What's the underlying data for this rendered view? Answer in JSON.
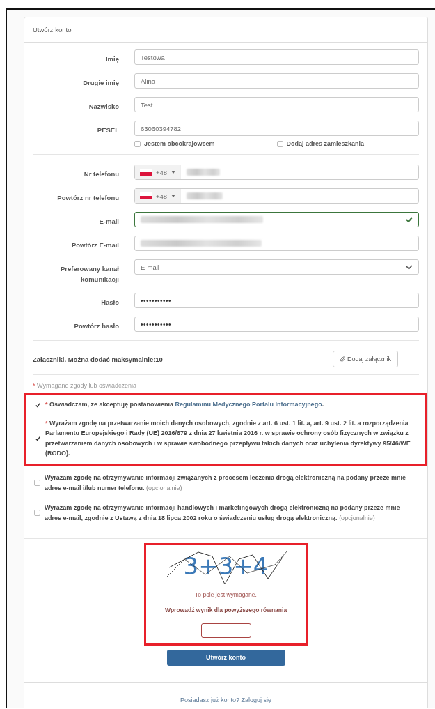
{
  "card_title": "Utwórz konto",
  "personal_fields": [
    {
      "label": "Imię",
      "value": "Testowa"
    },
    {
      "label": "Drugie imię",
      "value": "Alina"
    },
    {
      "label": "Nazwisko",
      "value": "Test"
    },
    {
      "label": "PESEL",
      "value": "63060394782"
    }
  ],
  "pesel_options": [
    {
      "label": "Jestem obcokrajowcem",
      "checked": false
    },
    {
      "label": "Dodaj adres zamieszkania",
      "checked": false
    }
  ],
  "contact_fields": [
    {
      "kind": "phone",
      "label": "Nr telefonu",
      "code": "+48"
    },
    {
      "kind": "phone",
      "label": "Powtórz nr telefonu",
      "code": "+48"
    },
    {
      "kind": "email",
      "label": "E-mail",
      "valid": true
    },
    {
      "kind": "email",
      "label": "Powtórz E-mail",
      "valid": false
    },
    {
      "kind": "select",
      "label": "Preferowany kanał komunikacji",
      "value": "E-mail"
    },
    {
      "kind": "password",
      "label": "Hasło",
      "value": "•••••••••••"
    },
    {
      "kind": "password",
      "label": "Powtórz hasło",
      "value": "•••••••••••"
    }
  ],
  "attachments": {
    "text": "Załączniki. Można dodać maksymalnie:10",
    "button": "Dodaj załącznik"
  },
  "consents_heading": {
    "mark": "*",
    "text": "Wymagane zgody lub oświadczenia"
  },
  "required_consents": {
    "highlighted": true,
    "items": [
      {
        "checked": true,
        "mark": "*",
        "text": "Oświadczam, że akceptuję postanowienia ",
        "link": "Regulaminu Medycznego Portalu Informacyjnego",
        "text_after": "."
      },
      {
        "checked": true,
        "mark": "*",
        "text": "Wyrażam zgodę na przetwarzanie moich danych osobowych, zgodnie z art. 6 ust. 1 lit. a, art. 9 ust. 2 lit. a rozporządzenia Parlamentu Europejskiego i Rady (UE) 2016/679 z dnia 27 kwietnia 2016 r. w sprawie ochrony osób fizycznych w związku z przetwarzaniem danych osobowych i w sprawie swobodnego przepływu takich danych oraz uchylenia dyrektywy 95/46/WE (RODO)."
      }
    ]
  },
  "optional_consents": [
    {
      "checked": false,
      "text": "Wyrażam zgodę na otrzymywanie informacji związanych z procesem leczenia drogą elektroniczną na podany przeze mnie adres e-mail i/lub numer telefonu. ",
      "note": "(opcjonalnie)"
    },
    {
      "checked": false,
      "text": "Wyrażam zgodę na otrzymywanie informacji handlowych i marketingowych drogą elektroniczną na podany przeze mnie adres e-mail, zgodnie z Ustawą z dnia 18 lipca 2002 roku o świadczeniu usług drogą elektroniczną. ",
      "note": "(opcjonalnie)"
    }
  ],
  "captcha": {
    "highlighted": true,
    "equation": "3+3+4",
    "error": "To pole jest wymagane.",
    "prompt": "Wprowadź wynik dla powyższego równania",
    "invalid": true,
    "focused": true
  },
  "submit_button": "Utwórz konto",
  "footer_link": "Posiadasz już konto? Zaloguj się"
}
